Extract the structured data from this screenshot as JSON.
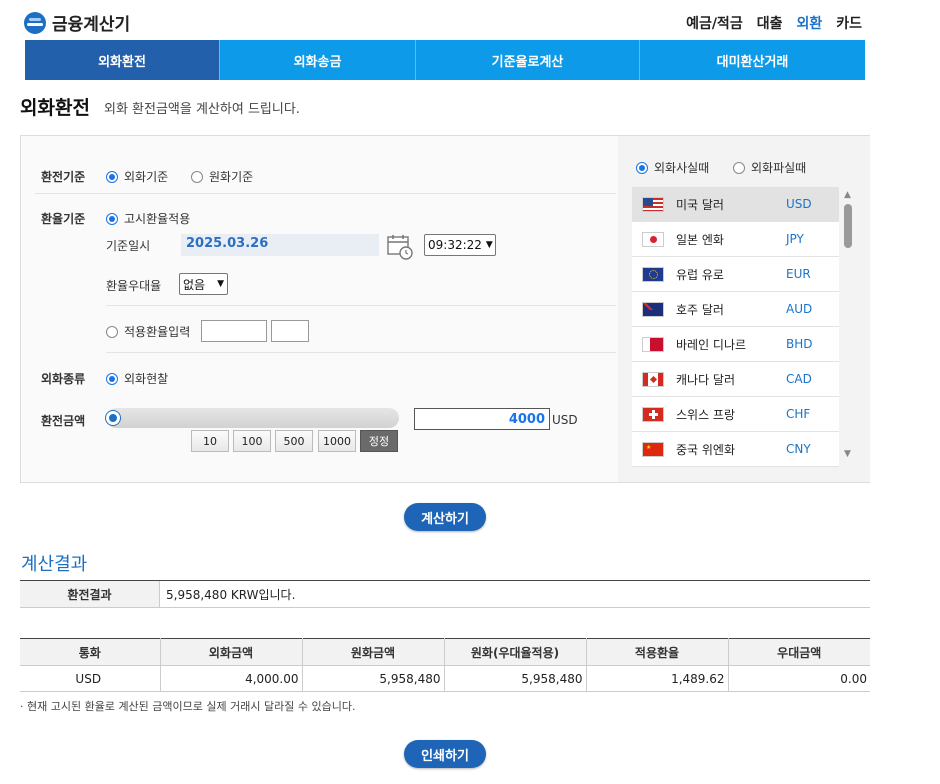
{
  "header": {
    "logo_text": "금융계산기",
    "nav": [
      "예금/적금",
      "대출",
      "외환",
      "카드"
    ],
    "active_nav_index": 2
  },
  "tabs": [
    "외화환전",
    "외화송금",
    "기준율로계산",
    "대미환산거래"
  ],
  "active_tab_index": 0,
  "title": {
    "main": "외화환전",
    "desc": "외화 환전금액을 계산하여 드립니다."
  },
  "form": {
    "basis_label": "환전기준",
    "basis_options": [
      "외화기준",
      "원화기준"
    ],
    "rate_label": "환율기준",
    "rate_option_notice": "고시환율적용",
    "date_label": "기준일시",
    "date_value": "2025.03.26",
    "time_value": "09:32:22",
    "discount_label": "환율우대율",
    "discount_value": "없음",
    "custom_rate_label": "적용환율입력",
    "type_label": "외화종류",
    "type_option": "외화현찰",
    "amount_label": "환전금액",
    "amount_value": "4000",
    "amount_unit": "USD",
    "quick_buttons": [
      "10",
      "100",
      "500",
      "1000",
      "정정"
    ],
    "slider_fraction": 0.0
  },
  "side": {
    "mode_options": [
      "외화사실때",
      "외화파실때"
    ],
    "currencies": [
      {
        "name": "미국 달러",
        "code": "USD"
      },
      {
        "name": "일본 엔화",
        "code": "JPY"
      },
      {
        "name": "유럽 유로",
        "code": "EUR"
      },
      {
        "name": "호주 달러",
        "code": "AUD"
      },
      {
        "name": "바레인 디나르",
        "code": "BHD"
      },
      {
        "name": "캐나다 달러",
        "code": "CAD"
      },
      {
        "name": "스위스 프랑",
        "code": "CHF"
      },
      {
        "name": "중국 위엔화",
        "code": "CNY"
      }
    ]
  },
  "calc_button": "계산하기",
  "result": {
    "title": "계산결과",
    "head": "환전결과",
    "value": "5,958,480 KRW입니다.",
    "columns": [
      "통화",
      "외화금액",
      "원화금액",
      "원화(우대율적용)",
      "적용환율",
      "우대금액"
    ],
    "row": [
      "USD",
      "4,000.00",
      "5,958,480",
      "5,958,480",
      "1,489.62",
      "0.00"
    ],
    "note": "· 현재 고시된 환율로 계산된 금액이므로 실제 거래시 달라질 수 있습니다."
  },
  "print_button": "인쇄하기"
}
